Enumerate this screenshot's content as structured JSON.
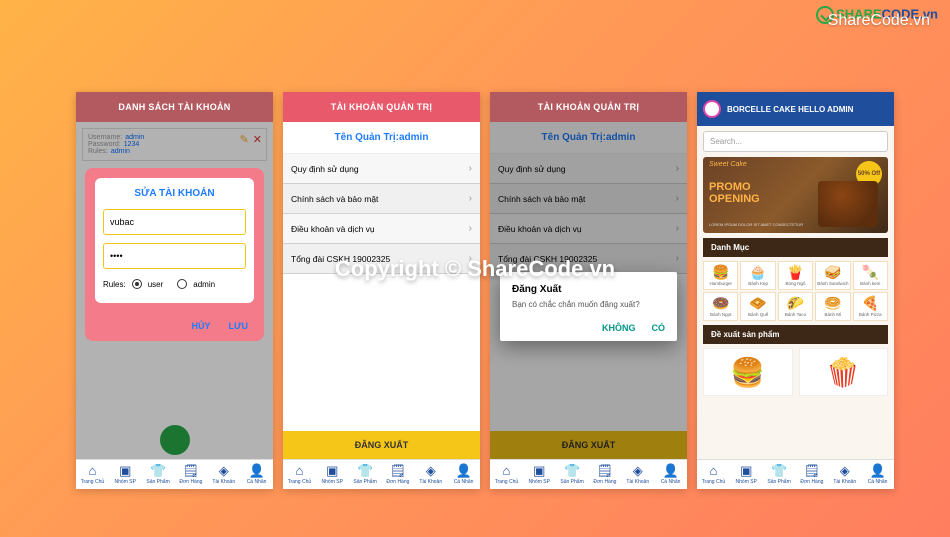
{
  "watermarks": {
    "top_right": "ShareCode.vn",
    "logo_green": "SHARE",
    "logo_blue": "CODE",
    "logo_suffix": ".vn",
    "center": "Copyright © ShareCode.vn"
  },
  "nav": {
    "items": [
      {
        "icon": "⌂",
        "label": "Trang Chủ"
      },
      {
        "icon": "▣",
        "label": "Nhóm SP"
      },
      {
        "icon": "👕",
        "label": "Sản Phẩm"
      },
      {
        "icon": "🗒",
        "label": "Đơn Hàng"
      },
      {
        "icon": "◈",
        "label": "Tài Khoản"
      },
      {
        "icon": "👤",
        "label": "Cá Nhân"
      }
    ]
  },
  "screen1": {
    "header": "DANH SÁCH TÀI KHOẢN",
    "account": {
      "username_k": "Username:",
      "username_v": "admin",
      "password_k": "Password:",
      "password_v": "1234",
      "rules_k": "Rules:",
      "rules_v": "admin"
    },
    "modal": {
      "title": "SỬA TÀI KHOẢN",
      "username": "vubac",
      "password": "••••",
      "rules_label": "Rules:",
      "opt_user": "user",
      "opt_admin": "admin",
      "cancel": "HỦY",
      "save": "LƯU"
    }
  },
  "screen2": {
    "header": "TÀI KHOẢN QUẢN TRỊ",
    "subheader": "Tên Quản Trị:admin",
    "menu": [
      "Quy định sử dụng",
      "Chính sách và bảo mật",
      "Điều khoản và dịch vụ",
      "Tổng đài CSKH 19002325"
    ],
    "logout": "ĐĂNG XUẤT"
  },
  "screen3": {
    "alert": {
      "title": "Đăng Xuất",
      "message": "Bạn có chắc chắn muốn đăng xuất?",
      "no": "KHÔNG",
      "yes": "CÓ"
    }
  },
  "screen4": {
    "header": "BORCELLE CAKE HELLO ADMIN",
    "search_placeholder": "Search...",
    "banner": {
      "sweet": "Sweet Cake",
      "promo1": "PROMO",
      "promo2": "OPENING",
      "off": "50% Off",
      "sub": "LOREM IPSUM DOLOR SIT AMET CONSECTETUR"
    },
    "sec_cat": "Danh Mục",
    "categories": [
      {
        "ic": "🍔",
        "lbl": "Hamburger"
      },
      {
        "ic": "🧁",
        "lbl": "Bánh Kẹp"
      },
      {
        "ic": "🍟",
        "lbl": "Bỏng Ngô"
      },
      {
        "ic": "🥪",
        "lbl": "Bánh Sandwich"
      },
      {
        "ic": "🍡",
        "lbl": "Bánh kem"
      },
      {
        "ic": "🍩",
        "lbl": "Bánh Ngọt"
      },
      {
        "ic": "🧇",
        "lbl": "Bánh Quế"
      },
      {
        "ic": "🌮",
        "lbl": "Bánh Taco"
      },
      {
        "ic": "🥯",
        "lbl": "Bánh Mì"
      },
      {
        "ic": "🍕",
        "lbl": "Bánh Pizza"
      }
    ],
    "sec_prod": "Đề xuất sản phẩm",
    "products": [
      "🍔",
      "🍿"
    ]
  }
}
